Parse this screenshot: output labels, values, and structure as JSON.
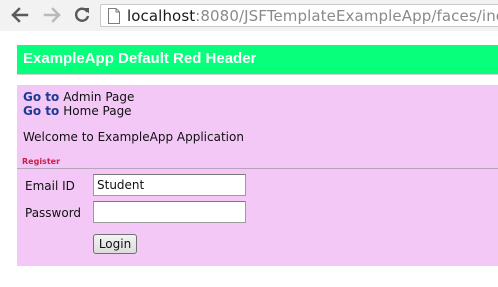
{
  "browser": {
    "url_host": "localhost",
    "url_rest": ":8080/JSFTemplateExampleApp/faces/inc",
    "icons": {
      "back": "arrow-left-icon",
      "forward": "arrow-right-icon",
      "reload": "reload-icon",
      "page": "page-icon"
    }
  },
  "header": {
    "title": "ExampleApp Default Red Header",
    "background_color": "#07ff7b"
  },
  "menu": {
    "admin": {
      "prefix": "Go to",
      "label": "Admin Page"
    },
    "home": {
      "prefix": "Go to",
      "label": "Home Page"
    }
  },
  "main": {
    "welcome": "Welcome to ExampleApp Application",
    "background_color": "#f3c8f6"
  },
  "register": {
    "heading": "Register",
    "heading_color": "#cc1e4a",
    "email": {
      "label": "Email ID",
      "value": "Student"
    },
    "password": {
      "label": "Password",
      "value": ""
    },
    "login_label": "Login"
  }
}
